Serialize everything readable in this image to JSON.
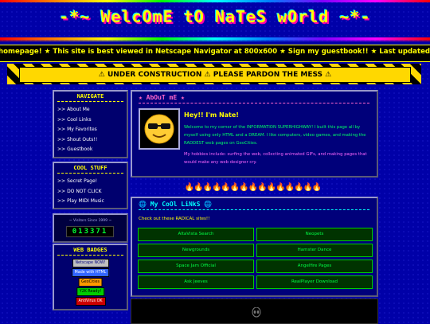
{
  "header": {
    "title": "-*~ WelcOmE tO NaTeS wOrld ~*-"
  },
  "marquee": {
    "text": "homepage! ★ This site is best viewed in Netscape Navigator at 800x600 ★ Sign my guestbook!! ★ Last updated: February 2026 ★ You won't BEL"
  },
  "construction": {
    "text": "⚠ UNDER CONSTRUCTION ⚠ PLEASE PARDON THE MESS ⚠"
  },
  "navigate": {
    "title": "NAVIGATE",
    "items": [
      {
        "label": "About Me"
      },
      {
        "label": "Cool Links"
      },
      {
        "label": "My Favorites"
      },
      {
        "label": "Shout Outs!!"
      },
      {
        "label": "Guestbook"
      }
    ]
  },
  "cool_stuff": {
    "title": "COOL STUFF",
    "items": [
      {
        "label": "Secret Page!"
      },
      {
        "label": "DO NOT CLICK"
      },
      {
        "label": "Play MIDI Music"
      }
    ]
  },
  "counter": {
    "label": "~ Visitors Since 1999 ~",
    "value": "013371"
  },
  "badges": {
    "title": "WEB BADGES",
    "items": [
      {
        "label": "Netscape NOW!",
        "bg": "#c0c0c0",
        "fg": "#000080"
      },
      {
        "label": "Made with HTML",
        "bg": "#3366ff",
        "fg": "#ffffff"
      },
      {
        "label": "GeoCities",
        "bg": "#ff9900",
        "fg": "#000000"
      },
      {
        "label": "Y2K Ready!",
        "bg": "#00cc00",
        "fg": "#000000"
      },
      {
        "label": "AntiVirus OK",
        "bg": "#cc0000",
        "fg": "#ffffff"
      }
    ]
  },
  "about": {
    "title": "★ AbOuT mE ★",
    "greeting": "Hey!! I'm Nate!",
    "p1": "Welcome to my corner of the INFORMATION SUPERHIGHWAY! I built this page all by myself using only HTML and a DREAM. I like computers, video games, and making the RADDEST web pages on GeoCities.",
    "p2": "My hobbies include: surfing the web, collecting animated GIFs, and making pages that would make any web designer cry.",
    "avatar_icon": "sunglasses-face-icon"
  },
  "fire_row": "🔥🔥🔥🔥🔥🔥🔥🔥🔥🔥🔥🔥🔥🔥🔥",
  "links": {
    "title": "🌐 My CoOl LiNkS 🌐",
    "intro": "Check out these RADICAL sites!!",
    "items": [
      {
        "label": "AltaVista Search"
      },
      {
        "label": "Neopets"
      },
      {
        "label": "Newgrounds"
      },
      {
        "label": "Hamster Dance"
      },
      {
        "label": "Space Jam Official"
      },
      {
        "label": "Angelfire Pages"
      },
      {
        "label": "Ask Jeeves"
      },
      {
        "label": "RealPlayer Download"
      }
    ]
  },
  "bottom": {
    "icon": "alien-icon"
  }
}
